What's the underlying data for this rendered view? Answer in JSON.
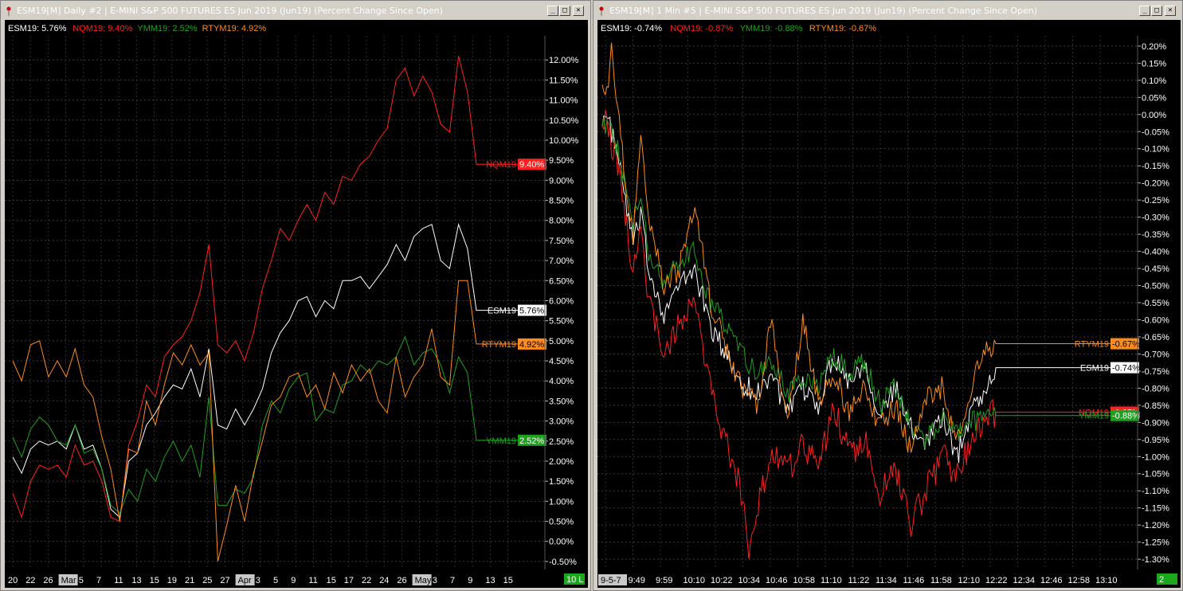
{
  "colors": {
    "ESM19": "#ffffff",
    "NQM19": "#ff2020",
    "YMM19": "#1fa01f",
    "RTYM19": "#ff8c1a"
  },
  "left": {
    "title": "ESM19[M]  Daily  #2 | E-MINI S&P 500 FUTURES ES Jun 2019 (Jun19) (Percent Change Since Open)",
    "legend": [
      {
        "name": "ESM19",
        "text": "ESM19: 5.76%"
      },
      {
        "name": "NQM19",
        "text": "NQM19: 9.40%"
      },
      {
        "name": "YMM19",
        "text": "YMM19: 2.52%"
      },
      {
        "name": "RTYM19",
        "text": "RTYM19: 4.92%"
      }
    ],
    "status_badge": "10 L",
    "axis_suffix": "%",
    "chart_data": {
      "type": "line",
      "ylim": [
        -0.7,
        12.6
      ],
      "yticks": [
        "12.00%",
        "11.50%",
        "11.00%",
        "10.50%",
        "10.00%",
        "9.50%",
        "9.00%",
        "8.50%",
        "8.00%",
        "7.50%",
        "7.00%",
        "6.50%",
        "6.00%",
        "5.50%",
        "5.00%",
        "4.50%",
        "4.00%",
        "3.50%",
        "3.00%",
        "2.50%",
        "2.00%",
        "1.50%",
        "1.00%",
        "0.50%",
        "0.00%",
        "-0.50%"
      ],
      "x_labels": [
        "20",
        "22",
        "26",
        "Mar",
        "5",
        "7",
        "11",
        "13",
        "15",
        "19",
        "21",
        "25",
        "27",
        "Apr",
        "3",
        "5",
        "9",
        "11",
        "15",
        "17",
        "22",
        "24",
        "26",
        "May",
        "3",
        "7",
        "9",
        "13",
        "15"
      ],
      "x_label_boxed": [
        "Mar",
        "Apr",
        "May"
      ],
      "n_bars": 52,
      "series": [
        {
          "name": "ESM19",
          "last_label": "5.76%",
          "values": [
            2.1,
            1.7,
            2.3,
            2.5,
            2.4,
            2.5,
            2.3,
            2.9,
            2.3,
            2.4,
            1.8,
            0.8,
            0.6,
            2.0,
            2.2,
            2.9,
            3.2,
            3.6,
            3.9,
            3.8,
            4.3,
            3.6,
            4.8,
            2.9,
            2.8,
            3.3,
            2.9,
            3.3,
            3.8,
            4.7,
            5.2,
            5.5,
            6.0,
            6.1,
            5.6,
            6.0,
            5.8,
            6.5,
            6.5,
            6.6,
            6.3,
            6.6,
            6.9,
            7.4,
            7.0,
            7.6,
            7.8,
            7.9,
            7.0,
            6.8,
            7.9,
            7.3,
            5.76
          ]
        },
        {
          "name": "NQM19",
          "last_label": "9.40%",
          "values": [
            1.2,
            0.6,
            1.5,
            1.9,
            1.8,
            1.9,
            1.6,
            2.4,
            1.9,
            2.0,
            1.5,
            0.6,
            0.5,
            2.4,
            3.0,
            3.9,
            3.6,
            4.6,
            4.9,
            5.1,
            5.5,
            6.2,
            7.4,
            4.9,
            4.7,
            5.0,
            4.5,
            5.2,
            6.3,
            7.0,
            7.8,
            7.5,
            8.0,
            8.4,
            8.0,
            8.7,
            8.4,
            9.1,
            9.0,
            9.4,
            9.6,
            10.0,
            10.3,
            11.5,
            11.8,
            11.1,
            11.6,
            11.2,
            10.4,
            10.2,
            12.1,
            11.2,
            9.4
          ]
        },
        {
          "name": "YMM19",
          "last_label": "2.52%",
          "values": [
            2.6,
            2.1,
            2.8,
            3.1,
            2.9,
            2.5,
            2.4,
            2.9,
            2.2,
            2.3,
            1.8,
            0.9,
            0.7,
            1.3,
            1.0,
            1.8,
            1.5,
            2.1,
            2.5,
            2.0,
            2.4,
            1.6,
            3.6,
            0.9,
            0.9,
            1.3,
            1.2,
            1.6,
            2.9,
            3.5,
            3.2,
            3.8,
            4.1,
            4.2,
            3.0,
            3.3,
            3.2,
            3.9,
            4.0,
            4.4,
            4.2,
            4.5,
            4.4,
            4.6,
            5.1,
            4.4,
            4.7,
            4.8,
            4.4,
            3.7,
            4.6,
            4.2,
            2.52
          ]
        },
        {
          "name": "RTYM19",
          "last_label": "4.92%",
          "values": [
            4.5,
            4.0,
            4.9,
            5.0,
            4.1,
            4.5,
            4.1,
            4.8,
            3.9,
            3.6,
            2.6,
            1.8,
            0.5,
            2.3,
            2.2,
            3.5,
            2.9,
            3.9,
            4.7,
            4.4,
            4.9,
            4.4,
            4.7,
            -0.5,
            0.4,
            1.4,
            0.5,
            1.7,
            2.5,
            3.4,
            3.6,
            4.1,
            4.2,
            3.6,
            3.9,
            3.3,
            4.2,
            3.7,
            4.4,
            4.0,
            4.3,
            3.5,
            3.2,
            4.6,
            3.6,
            4.1,
            4.4,
            5.3,
            4.1,
            3.9,
            6.5,
            6.5,
            4.92
          ]
        }
      ]
    }
  },
  "right": {
    "title": "ESM19[M]  1 Min   #5 | E-MINI S&P 500 FUTURES ES Jun 2019 (Jun19) (Percent Change Since Open)",
    "legend": [
      {
        "name": "ESM19",
        "text": "ESM19: -0.74%"
      },
      {
        "name": "NQM19",
        "text": "NQM19: -0.87%"
      },
      {
        "name": "YMM19",
        "text": "YMM19: -0.88%"
      },
      {
        "name": "RTYM19",
        "text": "RTYM19: -0.67%"
      }
    ],
    "status_badge": "2",
    "chart_data": {
      "type": "line",
      "ylim": [
        -1.33,
        0.23
      ],
      "yticks": [
        "0.20%",
        "0.15%",
        "0.10%",
        "0.05%",
        "0.00%",
        "-0.05%",
        "-0.10%",
        "-0.15%",
        "-0.20%",
        "-0.25%",
        "-0.30%",
        "-0.35%",
        "-0.40%",
        "-0.45%",
        "-0.50%",
        "-0.55%",
        "-0.60%",
        "-0.65%",
        "-0.70%",
        "-0.75%",
        "-0.80%",
        "-0.85%",
        "-0.90%",
        "-0.95%",
        "-1.00%",
        "-1.05%",
        "-1.10%",
        "-1.15%",
        "-1.20%",
        "-1.25%",
        "-1.30%"
      ],
      "x_labels": [
        "9-5-7",
        "9:49",
        "9:59",
        "10:10",
        "10:22",
        "10:34",
        "10:46",
        "10:58",
        "11:10",
        "11:22",
        "11:34",
        "11:46",
        "11:58",
        "12:10",
        "12:22",
        "12:34",
        "12:46",
        "12:58",
        "13:10"
      ],
      "x_label_boxed": [
        "9-5-7"
      ],
      "series": [
        {
          "name": "ESM19",
          "last_label": "0.74%",
          "keypoints": [
            [
              0,
              0.0
            ],
            [
              3,
              -0.02
            ],
            [
              6,
              -0.05
            ],
            [
              10,
              -0.12
            ],
            [
              15,
              -0.25
            ],
            [
              20,
              -0.38
            ],
            [
              25,
              -0.3
            ],
            [
              30,
              -0.45
            ],
            [
              40,
              -0.58
            ],
            [
              50,
              -0.5
            ],
            [
              60,
              -0.45
            ],
            [
              70,
              -0.62
            ],
            [
              80,
              -0.7
            ],
            [
              90,
              -0.78
            ],
            [
              100,
              -0.82
            ],
            [
              110,
              -0.75
            ],
            [
              120,
              -0.88
            ],
            [
              130,
              -0.8
            ],
            [
              140,
              -0.85
            ],
            [
              150,
              -0.7
            ],
            [
              160,
              -0.78
            ],
            [
              170,
              -0.72
            ],
            [
              180,
              -0.88
            ],
            [
              190,
              -0.8
            ],
            [
              200,
              -0.92
            ],
            [
              210,
              -0.95
            ],
            [
              220,
              -0.88
            ],
            [
              230,
              -1.0
            ],
            [
              240,
              -0.85
            ],
            [
              250,
              -0.8
            ],
            [
              255,
              -0.74
            ]
          ]
        },
        {
          "name": "NQM19",
          "last_label": "0.87%",
          "keypoints": [
            [
              0,
              0.01
            ],
            [
              3,
              -0.03
            ],
            [
              6,
              -0.08
            ],
            [
              10,
              -0.15
            ],
            [
              15,
              -0.3
            ],
            [
              20,
              -0.45
            ],
            [
              25,
              -0.35
            ],
            [
              30,
              -0.55
            ],
            [
              40,
              -0.7
            ],
            [
              50,
              -0.6
            ],
            [
              60,
              -0.55
            ],
            [
              70,
              -0.8
            ],
            [
              80,
              -0.95
            ],
            [
              90,
              -1.1
            ],
            [
              95,
              -1.3
            ],
            [
              100,
              -1.15
            ],
            [
              110,
              -1.0
            ],
            [
              120,
              -1.05
            ],
            [
              130,
              -0.95
            ],
            [
              140,
              -1.05
            ],
            [
              150,
              -0.85
            ],
            [
              160,
              -1.0
            ],
            [
              170,
              -0.95
            ],
            [
              180,
              -1.1
            ],
            [
              190,
              -1.05
            ],
            [
              200,
              -1.2
            ],
            [
              210,
              -1.1
            ],
            [
              220,
              -1.0
            ],
            [
              230,
              -1.05
            ],
            [
              240,
              -0.95
            ],
            [
              250,
              -0.88
            ],
            [
              255,
              -0.87
            ]
          ]
        },
        {
          "name": "YMM19",
          "last_label": "0.88%",
          "keypoints": [
            [
              0,
              0.0
            ],
            [
              3,
              -0.04
            ],
            [
              6,
              -0.06
            ],
            [
              10,
              -0.1
            ],
            [
              15,
              -0.22
            ],
            [
              20,
              -0.32
            ],
            [
              25,
              -0.25
            ],
            [
              30,
              -0.4
            ],
            [
              40,
              -0.5
            ],
            [
              50,
              -0.42
            ],
            [
              60,
              -0.4
            ],
            [
              70,
              -0.55
            ],
            [
              80,
              -0.62
            ],
            [
              90,
              -0.7
            ],
            [
              100,
              -0.75
            ],
            [
              110,
              -0.72
            ],
            [
              120,
              -0.82
            ],
            [
              130,
              -0.76
            ],
            [
              140,
              -0.8
            ],
            [
              150,
              -0.7
            ],
            [
              160,
              -0.75
            ],
            [
              170,
              -0.72
            ],
            [
              180,
              -0.85
            ],
            [
              190,
              -0.8
            ],
            [
              200,
              -0.9
            ],
            [
              210,
              -0.95
            ],
            [
              220,
              -0.88
            ],
            [
              230,
              -0.93
            ],
            [
              240,
              -0.9
            ],
            [
              250,
              -0.88
            ],
            [
              255,
              -0.88
            ]
          ]
        },
        {
          "name": "RTYM19",
          "last_label": "0.67%",
          "keypoints": [
            [
              0,
              0.12
            ],
            [
              3,
              0.05
            ],
            [
              6,
              0.18
            ],
            [
              10,
              0.02
            ],
            [
              15,
              -0.2
            ],
            [
              20,
              -0.35
            ],
            [
              25,
              -0.05
            ],
            [
              30,
              -0.3
            ],
            [
              40,
              -0.5
            ],
            [
              50,
              -0.45
            ],
            [
              60,
              -0.25
            ],
            [
              70,
              -0.55
            ],
            [
              80,
              -0.68
            ],
            [
              90,
              -0.8
            ],
            [
              100,
              -0.85
            ],
            [
              110,
              -0.6
            ],
            [
              120,
              -0.9
            ],
            [
              130,
              -0.6
            ],
            [
              140,
              -0.85
            ],
            [
              150,
              -0.75
            ],
            [
              160,
              -0.88
            ],
            [
              170,
              -0.8
            ],
            [
              180,
              -0.92
            ],
            [
              190,
              -0.85
            ],
            [
              200,
              -0.98
            ],
            [
              210,
              -0.82
            ],
            [
              220,
              -0.8
            ],
            [
              230,
              -0.95
            ],
            [
              240,
              -0.78
            ],
            [
              250,
              -0.68
            ],
            [
              255,
              -0.67
            ]
          ]
        }
      ]
    }
  }
}
